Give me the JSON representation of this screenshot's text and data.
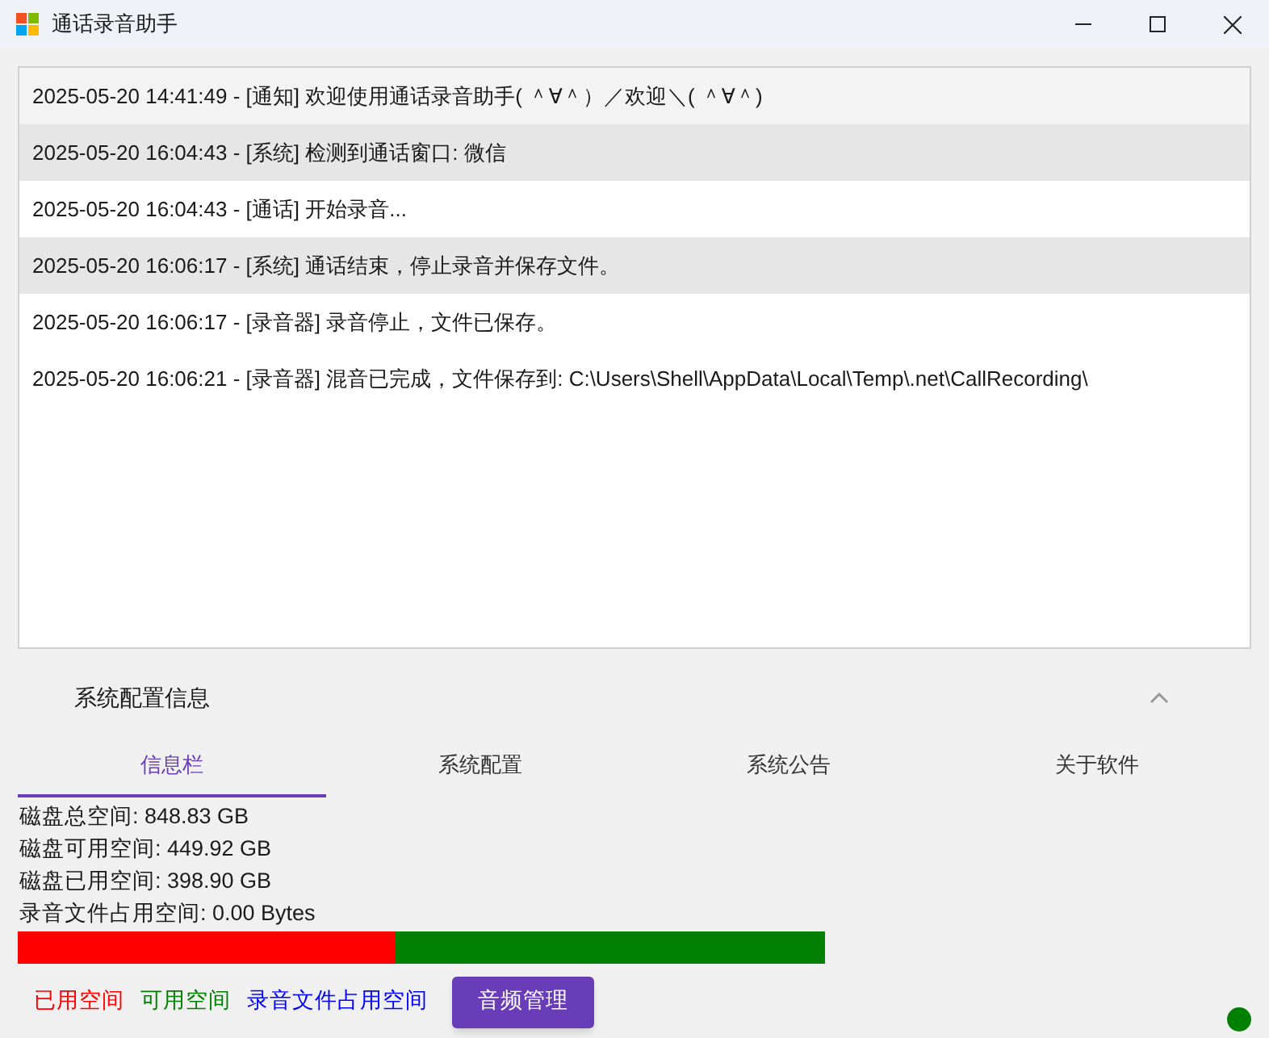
{
  "window": {
    "title": "通话录音助手"
  },
  "log": [
    {
      "text": "2025-05-20 14:41:49 - [通知] 欢迎使用通话录音助手( ＾∀＾）／欢迎＼( ＾∀＾)",
      "selected": false,
      "hovered": true
    },
    {
      "text": "2025-05-20 16:04:43 - [系统] 检测到通话窗口: 微信",
      "selected": true,
      "hovered": false
    },
    {
      "text": "2025-05-20 16:04:43 - [通话] 开始录音...",
      "selected": false,
      "hovered": false
    },
    {
      "text": "2025-05-20 16:06:17 - [系统] 通话结束，停止录音并保存文件。",
      "selected": true,
      "hovered": false
    },
    {
      "text": "2025-05-20 16:06:17 - [录音器] 录音停止，文件已保存。",
      "selected": false,
      "hovered": false
    },
    {
      "text": "2025-05-20 16:06:21 - [录音器] 混音已完成，文件保存到: C:\\Users\\Shell\\AppData\\Local\\Temp\\.net\\CallRecording\\",
      "selected": false,
      "hovered": false
    }
  ],
  "expander": {
    "title": "系统配置信息",
    "expanded": true
  },
  "tabs": [
    {
      "label": "信息栏",
      "selected": true
    },
    {
      "label": "系统配置",
      "selected": false
    },
    {
      "label": "系统公告",
      "selected": false
    },
    {
      "label": "关于软件",
      "selected": false
    }
  ],
  "disk_info": [
    "磁盘总空间: 848.83 GB",
    "磁盘可用空间: 449.92 GB",
    "磁盘已用空间: 398.90 GB",
    "录音文件占用空间: 0.00 Bytes"
  ],
  "usage_bar": {
    "level": 0.468,
    "color": "#ff0000",
    "track": {
      "color": "#008000"
    }
  },
  "legend": [
    {
      "label": "已用空间",
      "color": "#ff0000"
    },
    {
      "label": "可用空间",
      "color": "#008000"
    },
    {
      "label": "录音文件占用空间",
      "color": "#0000ff"
    }
  ],
  "audio_button": "音频管理",
  "status_dot": {
    "color": "#008000"
  }
}
